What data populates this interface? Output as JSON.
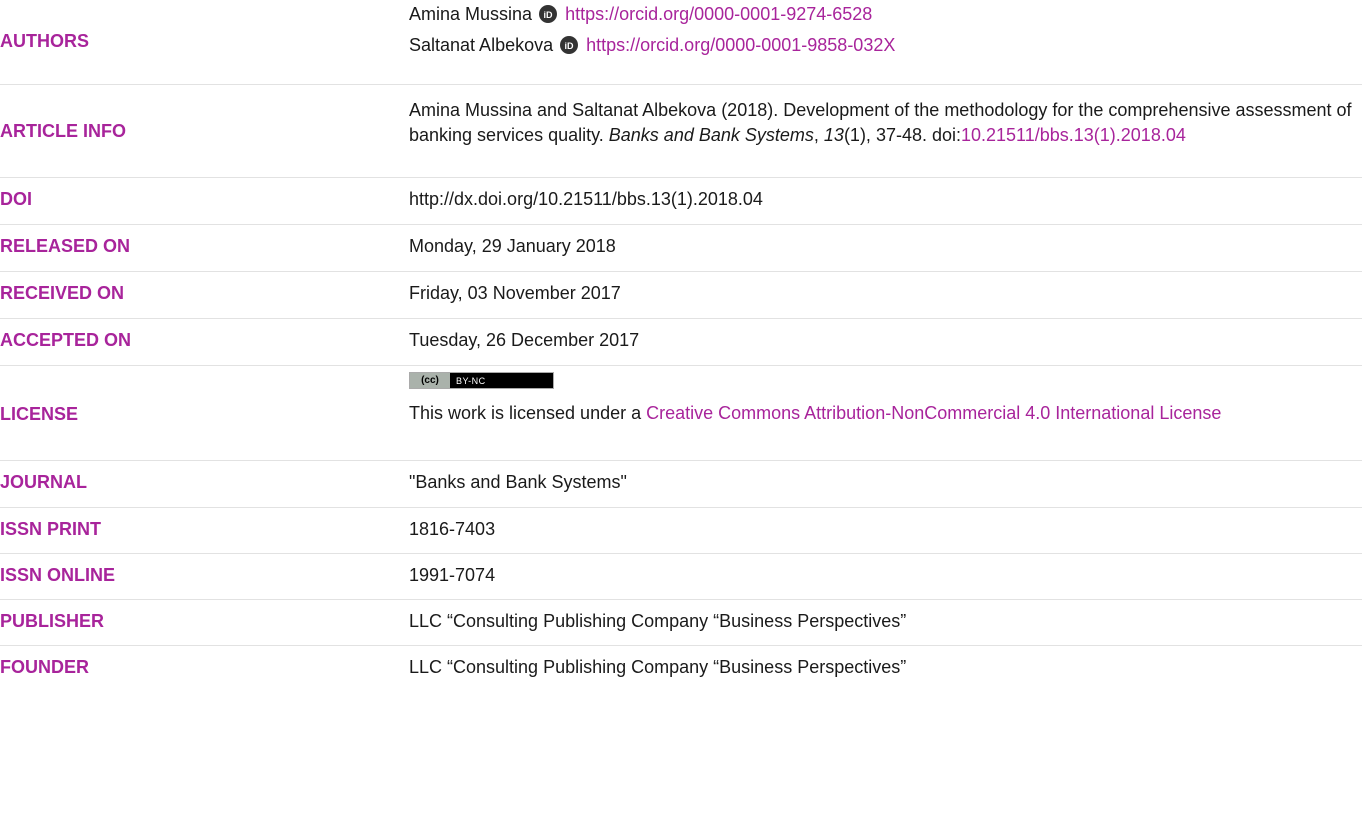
{
  "authors": {
    "label": "AUTHORS",
    "items": [
      {
        "name": "Amina Mussina",
        "orcid": "https://orcid.org/0000-0001-9274-6528"
      },
      {
        "name": "Saltanat Albekova",
        "orcid": "https://orcid.org/0000-0001-9858-032X"
      }
    ]
  },
  "article_info": {
    "label": "ARTICLE INFO",
    "prefix": "Amina Mussina and Saltanat Albekova (2018). Development of the methodology for the comprehensive assessment of banking services quality. ",
    "journal": "Banks and Bank Systems",
    "comma": ", ",
    "volume": "13",
    "issue_pages": "(1), 37-48. doi:",
    "doi_link": "10.21511/bbs.13(1).2018.04"
  },
  "doi": {
    "label": "DOI",
    "value": "http://dx.doi.org/10.21511/bbs.13(1).2018.04"
  },
  "released": {
    "label": "RELEASED ON",
    "value": "Monday, 29 January 2018"
  },
  "received": {
    "label": "RECEIVED ON",
    "value": "Friday, 03 November 2017"
  },
  "accepted": {
    "label": "ACCEPTED ON",
    "value": "Tuesday, 26 December 2017"
  },
  "license": {
    "label": "LICENSE",
    "badge_left": "(cc)",
    "badge_right": "BY-NC",
    "prefix": "This work is licensed under a ",
    "link": "Creative Commons Attribution-NonCommercial 4.0 International License"
  },
  "journal": {
    "label": "JOURNAL",
    "value": "\"Banks and Bank Systems\""
  },
  "issn_print": {
    "label": "ISSN PRINT",
    "value": "1816-7403"
  },
  "issn_online": {
    "label": "ISSN ONLINE",
    "value": "1991-7074"
  },
  "publisher": {
    "label": "PUBLISHER",
    "value": "LLC “Consulting Publishing Company “Business Perspectives”"
  },
  "founder": {
    "label": "FOUNDER",
    "value": "LLC “Consulting Publishing Company “Business Perspectives”"
  },
  "colors": {
    "accent": "#a8249b",
    "text": "#1a1a1a",
    "divider": "#e2e2e2"
  }
}
